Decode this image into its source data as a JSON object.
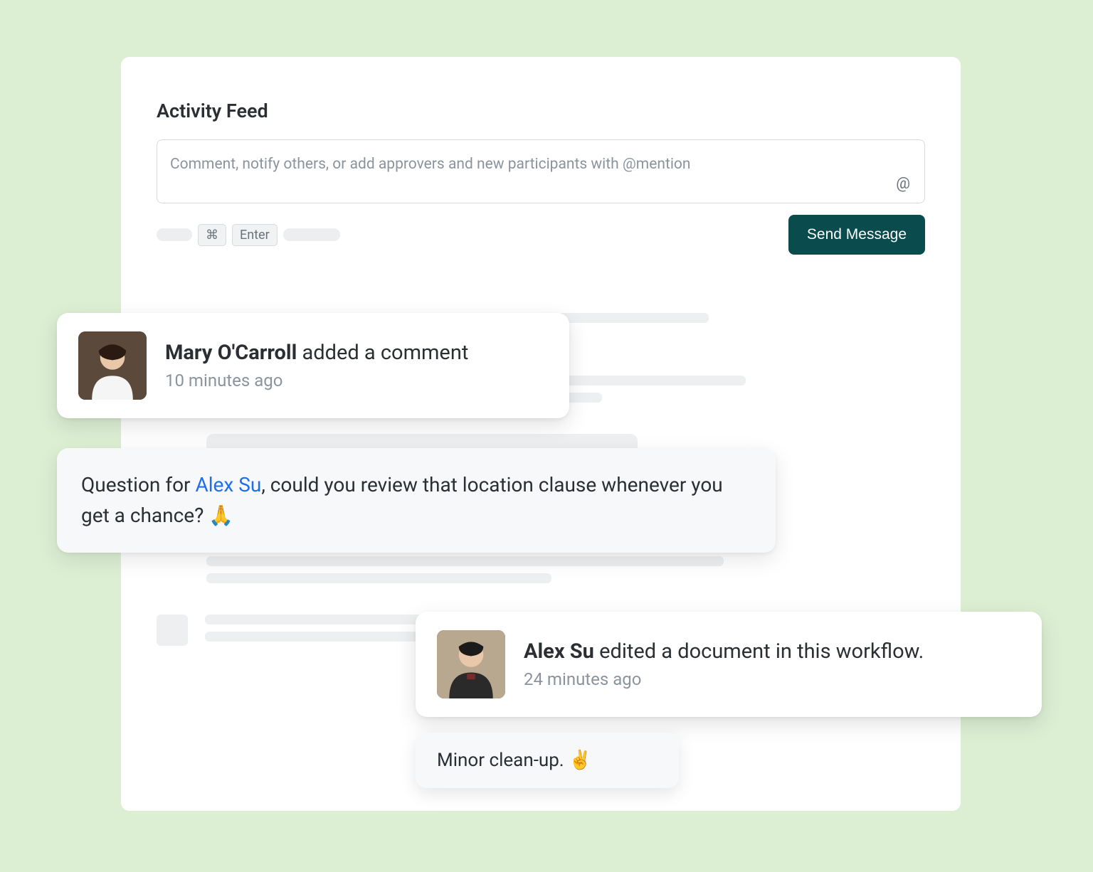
{
  "panel": {
    "title": "Activity Feed"
  },
  "composer": {
    "placeholder": "Comment, notify others, or add approvers and new participants with @mention",
    "at_icon": "@",
    "keys": {
      "cmd": "⌘",
      "enter": "Enter"
    },
    "send_label": "Send Message"
  },
  "feed": {
    "mary": {
      "name": "Mary O'Carroll",
      "action": " added a comment",
      "time": "10 minutes ago",
      "comment_before_mention": "Question for ",
      "mention": "Alex Su",
      "comment_after_mention": ", could you review that location clause whenever you get a chance? ",
      "emoji": "🙏"
    },
    "alex": {
      "name": "Alex Su",
      "action": " edited a document in this workflow.",
      "time": "24 minutes ago",
      "comment": "Minor clean-up. ",
      "emoji": "✌️"
    }
  }
}
